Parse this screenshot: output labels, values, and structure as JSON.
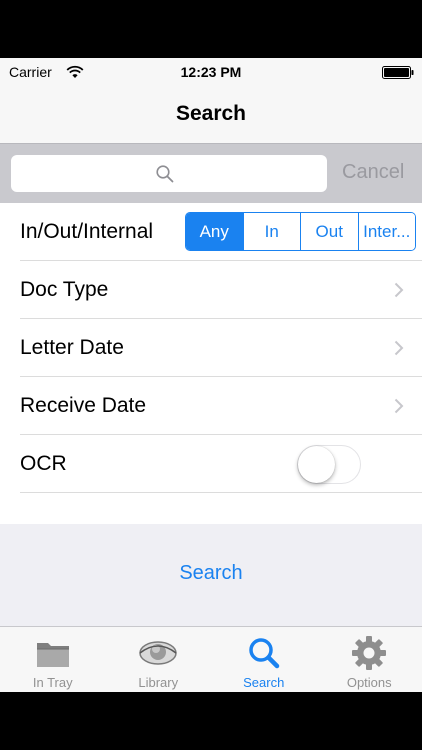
{
  "status_bar": {
    "carrier": "Carrier",
    "time": "12:23 PM"
  },
  "nav": {
    "title": "Search"
  },
  "search_bar": {
    "value": "",
    "cancel_label": "Cancel"
  },
  "form": {
    "direction": {
      "label": "In/Out/Internal",
      "options": [
        "Any",
        "In",
        "Out",
        "Inter..."
      ],
      "selected": "Any"
    },
    "doc_type_label": "Doc Type",
    "letter_date_label": "Letter Date",
    "receive_date_label": "Receive Date",
    "ocr": {
      "label": "OCR",
      "enabled": false
    }
  },
  "search_button_label": "Search",
  "tab_bar": {
    "selected": "Search",
    "tabs": [
      {
        "label": "In Tray",
        "icon": "folder-icon"
      },
      {
        "label": "Library",
        "icon": "eye-icon"
      },
      {
        "label": "Search",
        "icon": "magnifier-icon"
      },
      {
        "label": "Options",
        "icon": "gear-icon"
      }
    ]
  },
  "colors": {
    "accent": "#1a82f0",
    "inactive_tab": "#929292",
    "search_bar_bg": "#c9c9ce",
    "grouped_bg": "#efeff4"
  }
}
